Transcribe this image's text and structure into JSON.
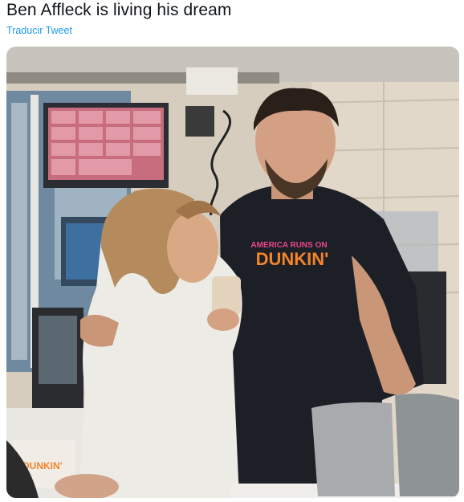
{
  "tweet": {
    "text": "Ben Affleck is living his dream",
    "translate_label": "Traducir Tweet"
  },
  "media": {
    "shirt_text_top": "AMERICA RUNS ON",
    "shirt_text_brand": "DUNKIN'",
    "cup_text": "DUNKIN'",
    "colors": {
      "shirt_orange": "#f2842a",
      "shirt_pink": "#e8478b",
      "shirt": "#1c1f26",
      "jacket": "#ecebe6"
    }
  }
}
